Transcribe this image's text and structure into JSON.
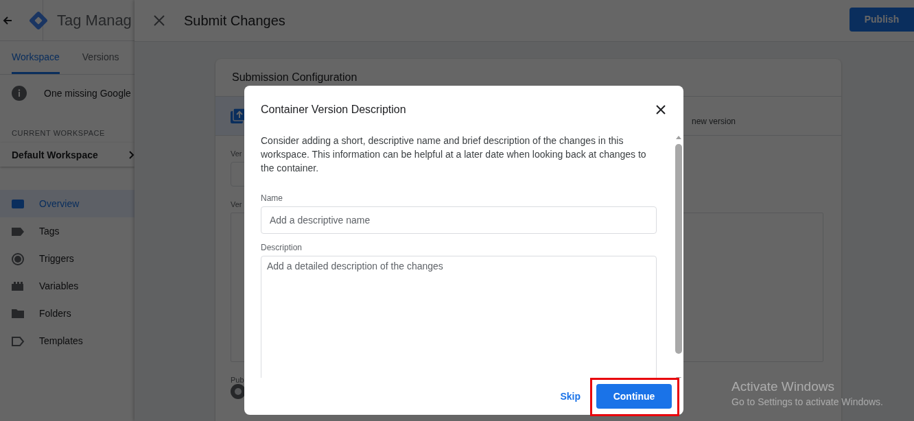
{
  "sidebar": {
    "app_title": "Tag Manag",
    "tabs": [
      {
        "label": "Workspace",
        "selected": true
      },
      {
        "label": "Versions",
        "selected": false
      }
    ],
    "notice": "One missing Google",
    "workspace_heading": "CURRENT WORKSPACE",
    "workspace": "Default Workspace",
    "nav": [
      {
        "label": "Overview",
        "kind": "overview",
        "selected": true
      },
      {
        "label": "Tags",
        "kind": "tags",
        "selected": false
      },
      {
        "label": "Triggers",
        "kind": "triggers",
        "selected": false
      },
      {
        "label": "Variables",
        "kind": "variables",
        "selected": false
      },
      {
        "label": "Folders",
        "kind": "folders",
        "selected": false
      },
      {
        "label": "Templates",
        "kind": "templates",
        "selected": false
      }
    ]
  },
  "header": {
    "title": "Submit Changes",
    "publish": "Publish"
  },
  "card": {
    "title": "Submission Configuration",
    "option_text": "new version",
    "label_1": "Ver",
    "label_2": "Ver",
    "label_3": "Pub"
  },
  "dialog": {
    "title": "Container Version Description",
    "intro": "Consider adding a short, descriptive name and brief description of the changes in this workspace. This information can be helpful at a later date when looking back at changes to the container.",
    "name_label": "Name",
    "name_placeholder": "Add a descriptive name",
    "description_label": "Description",
    "description_placeholder": "Add a detailed description of the changes",
    "skip": "Skip",
    "continue": "Continue"
  },
  "windows_notice": {
    "title": "Activate Windows",
    "subtitle": "Go to Settings to activate Windows."
  }
}
